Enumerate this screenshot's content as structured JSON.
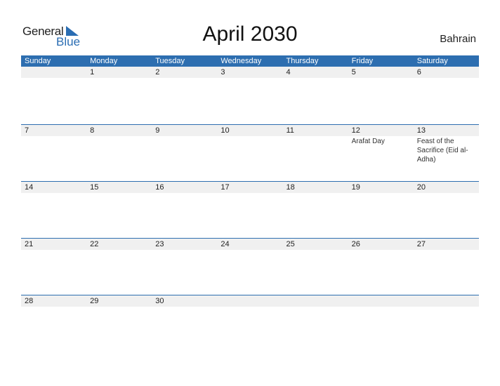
{
  "logo": {
    "general": "General",
    "blue": "Blue",
    "accent_color": "#2a6db3"
  },
  "title": "April 2030",
  "country": "Bahrain",
  "colors": {
    "header_bg": "#2d6eb0",
    "date_row_bg": "#f0f0f0"
  },
  "weekdays": [
    "Sunday",
    "Monday",
    "Tuesday",
    "Wednesday",
    "Thursday",
    "Friday",
    "Saturday"
  ],
  "weeks": [
    {
      "days": [
        "",
        "1",
        "2",
        "3",
        "4",
        "5",
        "6"
      ],
      "events": [
        "",
        "",
        "",
        "",
        "",
        "",
        ""
      ]
    },
    {
      "days": [
        "7",
        "8",
        "9",
        "10",
        "11",
        "12",
        "13"
      ],
      "events": [
        "",
        "",
        "",
        "",
        "",
        "Arafat Day",
        "Feast of the Sacrifice (Eid al-Adha)"
      ]
    },
    {
      "days": [
        "14",
        "15",
        "16",
        "17",
        "18",
        "19",
        "20"
      ],
      "events": [
        "",
        "",
        "",
        "",
        "",
        "",
        ""
      ]
    },
    {
      "days": [
        "21",
        "22",
        "23",
        "24",
        "25",
        "26",
        "27"
      ],
      "events": [
        "",
        "",
        "",
        "",
        "",
        "",
        ""
      ]
    },
    {
      "days": [
        "28",
        "29",
        "30",
        "",
        "",
        "",
        ""
      ],
      "events": [
        "",
        "",
        "",
        "",
        "",
        "",
        ""
      ]
    }
  ]
}
